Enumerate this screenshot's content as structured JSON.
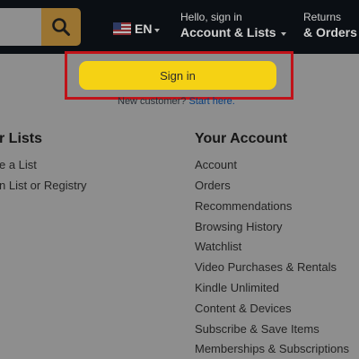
{
  "header": {
    "language": "EN",
    "account_greeting": "Hello, sign in",
    "account_label": "Account & Lists",
    "returns_line1": "Returns",
    "returns_line2": "& Orders"
  },
  "flyout": {
    "signin_label": "Sign in",
    "new_customer_text": "New customer?",
    "new_customer_link": "Start here.",
    "lists_title": "r Lists",
    "lists_items": [
      "e a List",
      "n List or Registry"
    ],
    "account_title": "Your Account",
    "account_items": [
      "Account",
      "Orders",
      "Recommendations",
      "Browsing History",
      "Watchlist",
      "Video Purchases & Rentals",
      "Kindle Unlimited",
      "Content & Devices",
      "Subscribe & Save Items",
      "Memberships & Subscriptions"
    ]
  },
  "icons": {
    "search": "search-icon",
    "flag": "us-flag-icon"
  },
  "colors": {
    "header_bg": "#0b0f14",
    "search_button": "#9a7432",
    "signin_button": "#f5d214",
    "highlight_border": "#c0131a",
    "link": "#0a3d7a",
    "overlay_bg": "#8e8e8e"
  }
}
